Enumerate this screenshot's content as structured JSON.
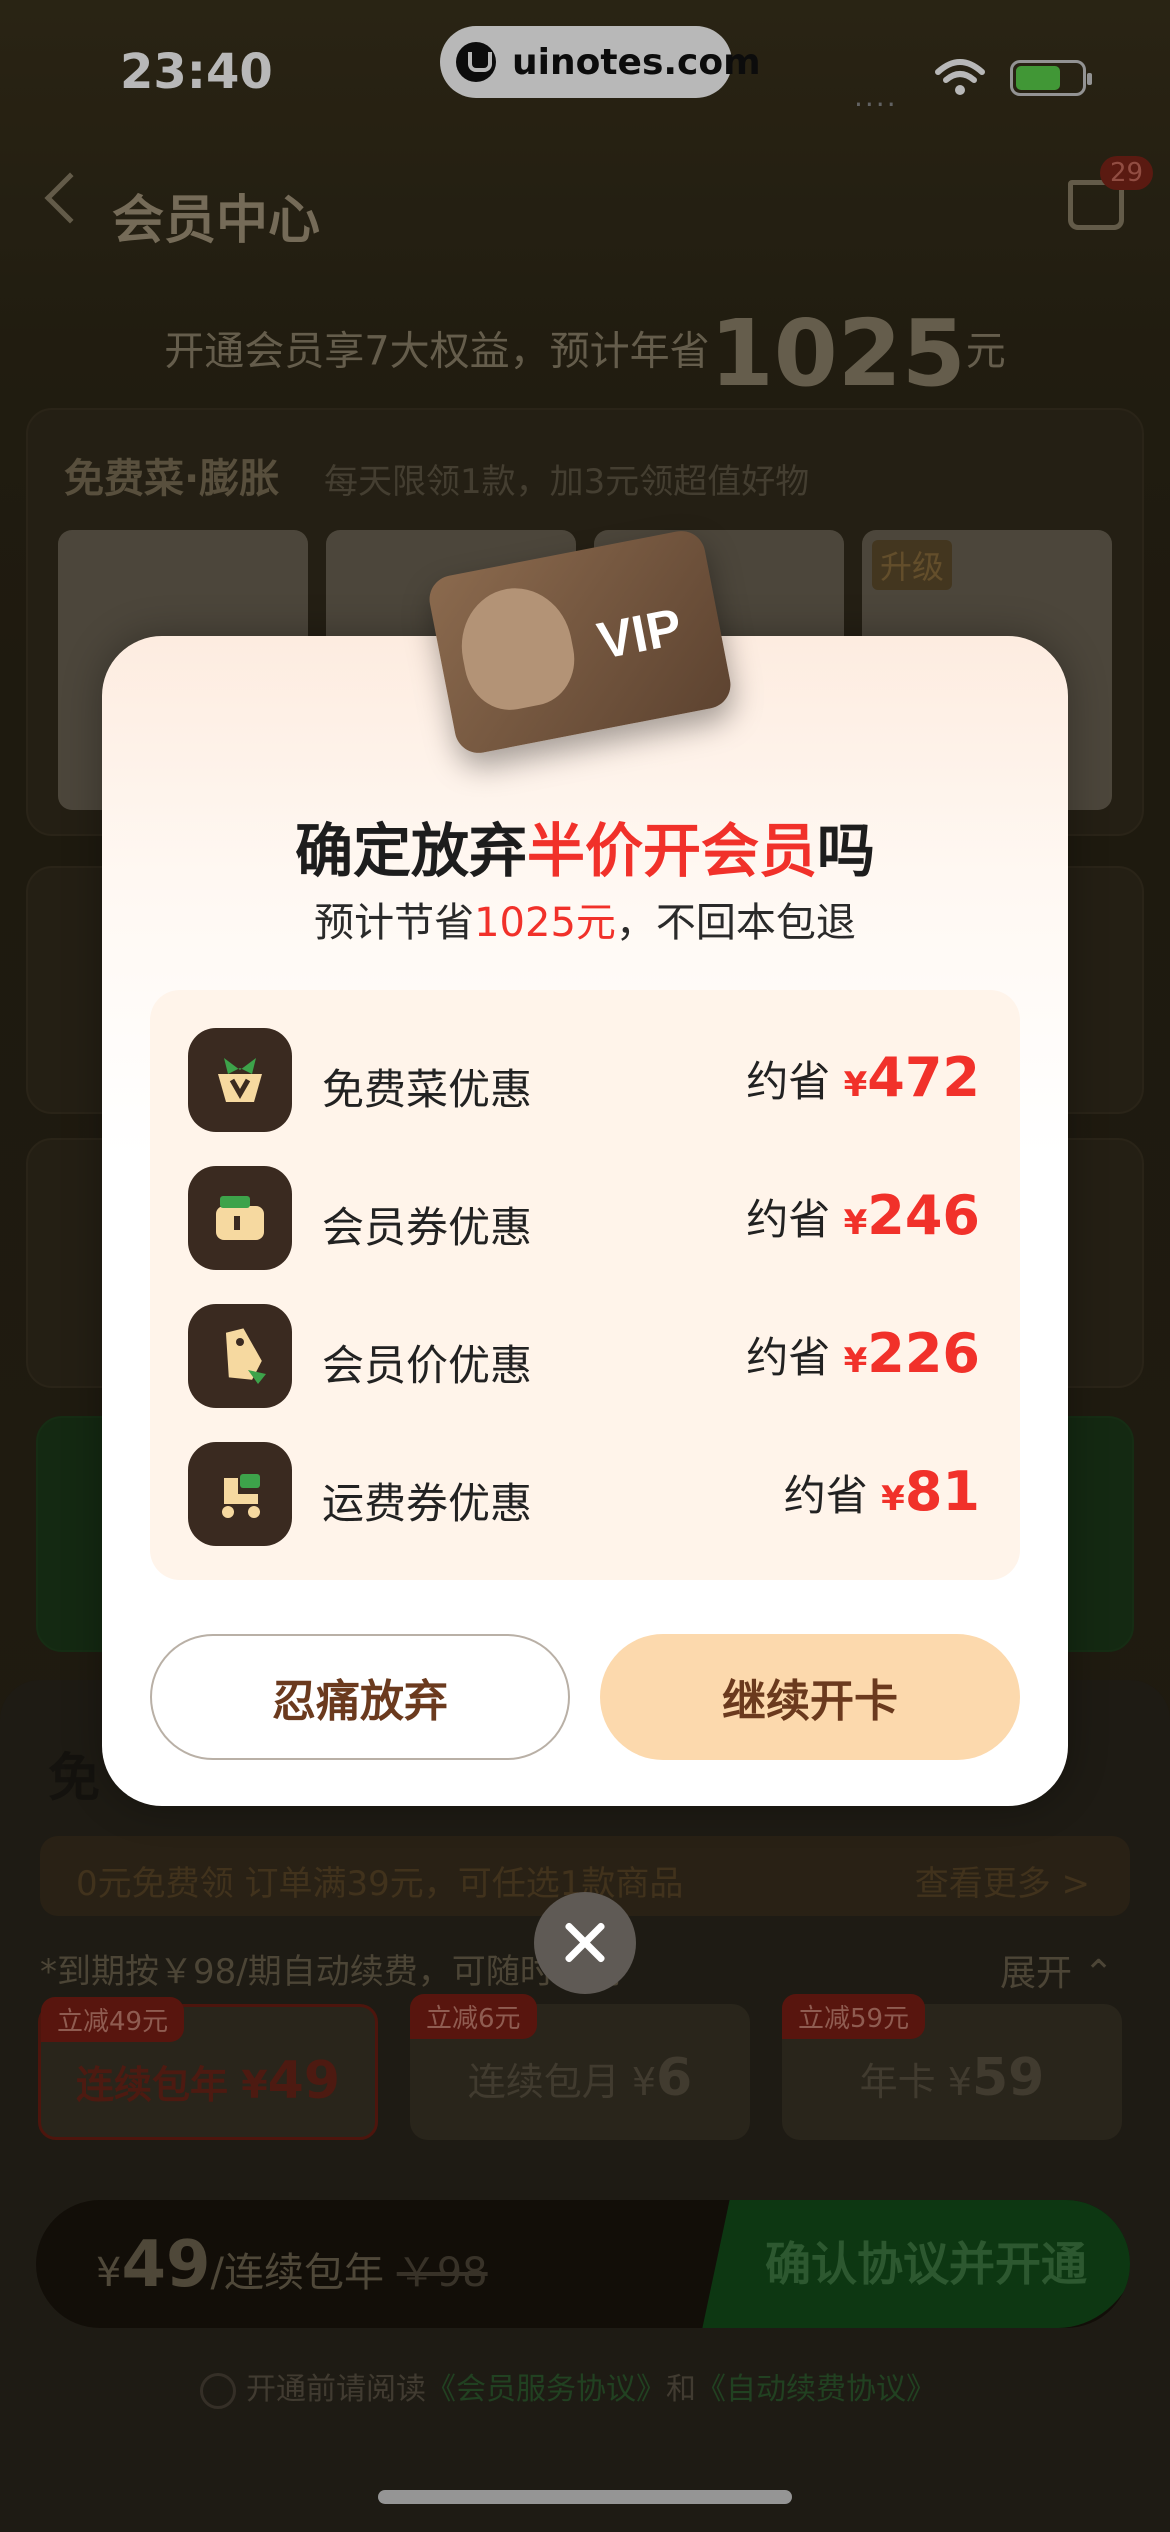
{
  "status_bar": {
    "time": "23:40",
    "url": "uinotes.com",
    "signal": "....",
    "battery_color": "#5ad14c"
  },
  "header": {
    "title": "会员中心",
    "cart_count": "29"
  },
  "tagline": {
    "text": "开通会员享7大权益，预计年省",
    "amount": "1025",
    "unit": "元"
  },
  "free_card": {
    "title": "免费菜·膨胀",
    "desc": "每天限领1款，加3元领超值好物",
    "upgrade_tag": "升级"
  },
  "modal": {
    "title_prefix": "确定放弃",
    "title_highlight": "半价开会员",
    "title_suffix": "吗",
    "sub_prefix": "预计节省",
    "sub_amount": "1025元",
    "sub_suffix": "，不回本包退",
    "benefits": [
      {
        "icon": "vegetable-icon",
        "label": "免费菜优惠",
        "save_prefix": "约省",
        "currency": "¥",
        "amount": "472"
      },
      {
        "icon": "coupon-icon",
        "label": "会员券优惠",
        "save_prefix": "约省",
        "currency": "¥",
        "amount": "246"
      },
      {
        "icon": "price-tag-icon",
        "label": "会员价优惠",
        "save_prefix": "约省",
        "currency": "¥",
        "amount": "226"
      },
      {
        "icon": "delivery-icon",
        "label": "运费券优惠",
        "save_prefix": "约省",
        "currency": "¥",
        "amount": "81"
      }
    ],
    "quit_label": "忍痛放弃",
    "continue_label": "继续开卡"
  },
  "sheet": {
    "title": "免",
    "free_pick": "0元免费领 订单满39元，可任选1款商品",
    "see_more": "查看更多 >",
    "renew_note": "*到期按￥98/期自动续费，可随时取消",
    "expand": "展开 ⌃",
    "plans": [
      {
        "tag": "立减49元",
        "name": "连续包年",
        "currency": "¥",
        "price": "49"
      },
      {
        "tag": "立减6元",
        "name": "连续包月",
        "currency": "¥",
        "price": "6"
      },
      {
        "tag": "立减59元",
        "name": "年卡",
        "currency": "¥",
        "price": "59"
      }
    ],
    "pay": {
      "currency": "¥",
      "price": "49",
      "period": "/连续包年",
      "old_price": "￥98",
      "confirm": "确认协议并开通"
    },
    "agreement": {
      "prefix": "开通前请阅读",
      "link1": "《会员服务协议》",
      "and": "和",
      "link2": "《自动续费协议》"
    }
  },
  "colors": {
    "accent_red": "#f1312a",
    "button_peach": "#fcd9ad",
    "brown_text": "#6b3a1e"
  }
}
